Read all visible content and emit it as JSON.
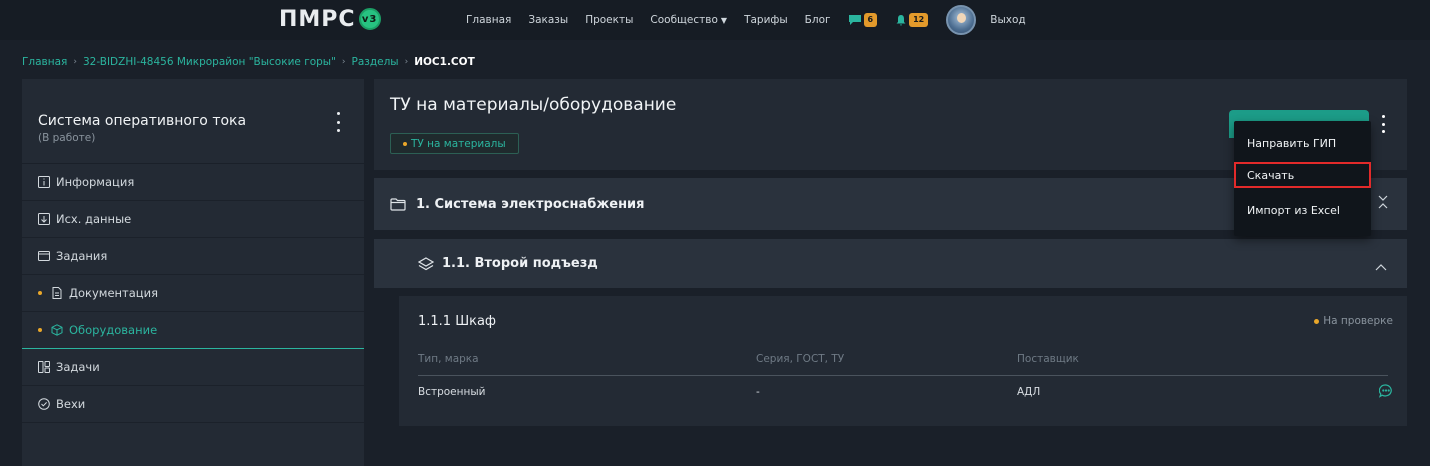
{
  "header": {
    "logo_text": "ПМРС",
    "logo_badge": "v3",
    "nav": [
      {
        "label": "Главная"
      },
      {
        "label": "Заказы"
      },
      {
        "label": "Проекты"
      },
      {
        "label": "Сообщество"
      },
      {
        "label": "Тарифы"
      },
      {
        "label": "Блог"
      }
    ],
    "messages_count": "6",
    "notifications_count": "12",
    "logout_label": "Выход"
  },
  "breadcrumb": {
    "home": "Главная",
    "project": "32-BIDZHI-48456 Микрорайон \"Высокие горы\"",
    "sections": "Разделы",
    "current": "ИОС1.СОТ"
  },
  "sidebar": {
    "title": "Система оперативного тока",
    "subtitle": "(В работе)",
    "items": [
      {
        "label": "Информация",
        "icon": "info-icon"
      },
      {
        "label": "Исх. данные",
        "icon": "download-icon"
      },
      {
        "label": "Задания",
        "icon": "tasks-icon"
      },
      {
        "label": "Документация",
        "icon": "document-icon"
      },
      {
        "label": "Оборудование",
        "icon": "box-icon"
      },
      {
        "label": "Задачи",
        "icon": "kanban-icon"
      },
      {
        "label": "Вехи",
        "icon": "check-circle-icon"
      }
    ]
  },
  "main": {
    "title": "ТУ на материалы/оборудование",
    "tag": "ТУ на материалы"
  },
  "dropdown": {
    "items": [
      {
        "label": "Направить ГИП"
      },
      {
        "label": "Скачать"
      },
      {
        "label": "Импорт из Excel"
      }
    ]
  },
  "section": {
    "title": "1. Система электроснабжения"
  },
  "subsection": {
    "title": "1.1. Второй подъезд"
  },
  "item": {
    "title": "1.1.1 Шкаф",
    "status": "На проверке",
    "columns": [
      "Тип, марка",
      "Серия, ГОСТ, ТУ",
      "Поставщик"
    ],
    "row": [
      "Встроенный",
      "-",
      "АДЛ"
    ]
  },
  "colors": {
    "accent": "#2bb59f",
    "background": "#1a2029",
    "panel": "#232a34",
    "status_dot": "#e9a72a",
    "highlight": "#e22a2a"
  }
}
